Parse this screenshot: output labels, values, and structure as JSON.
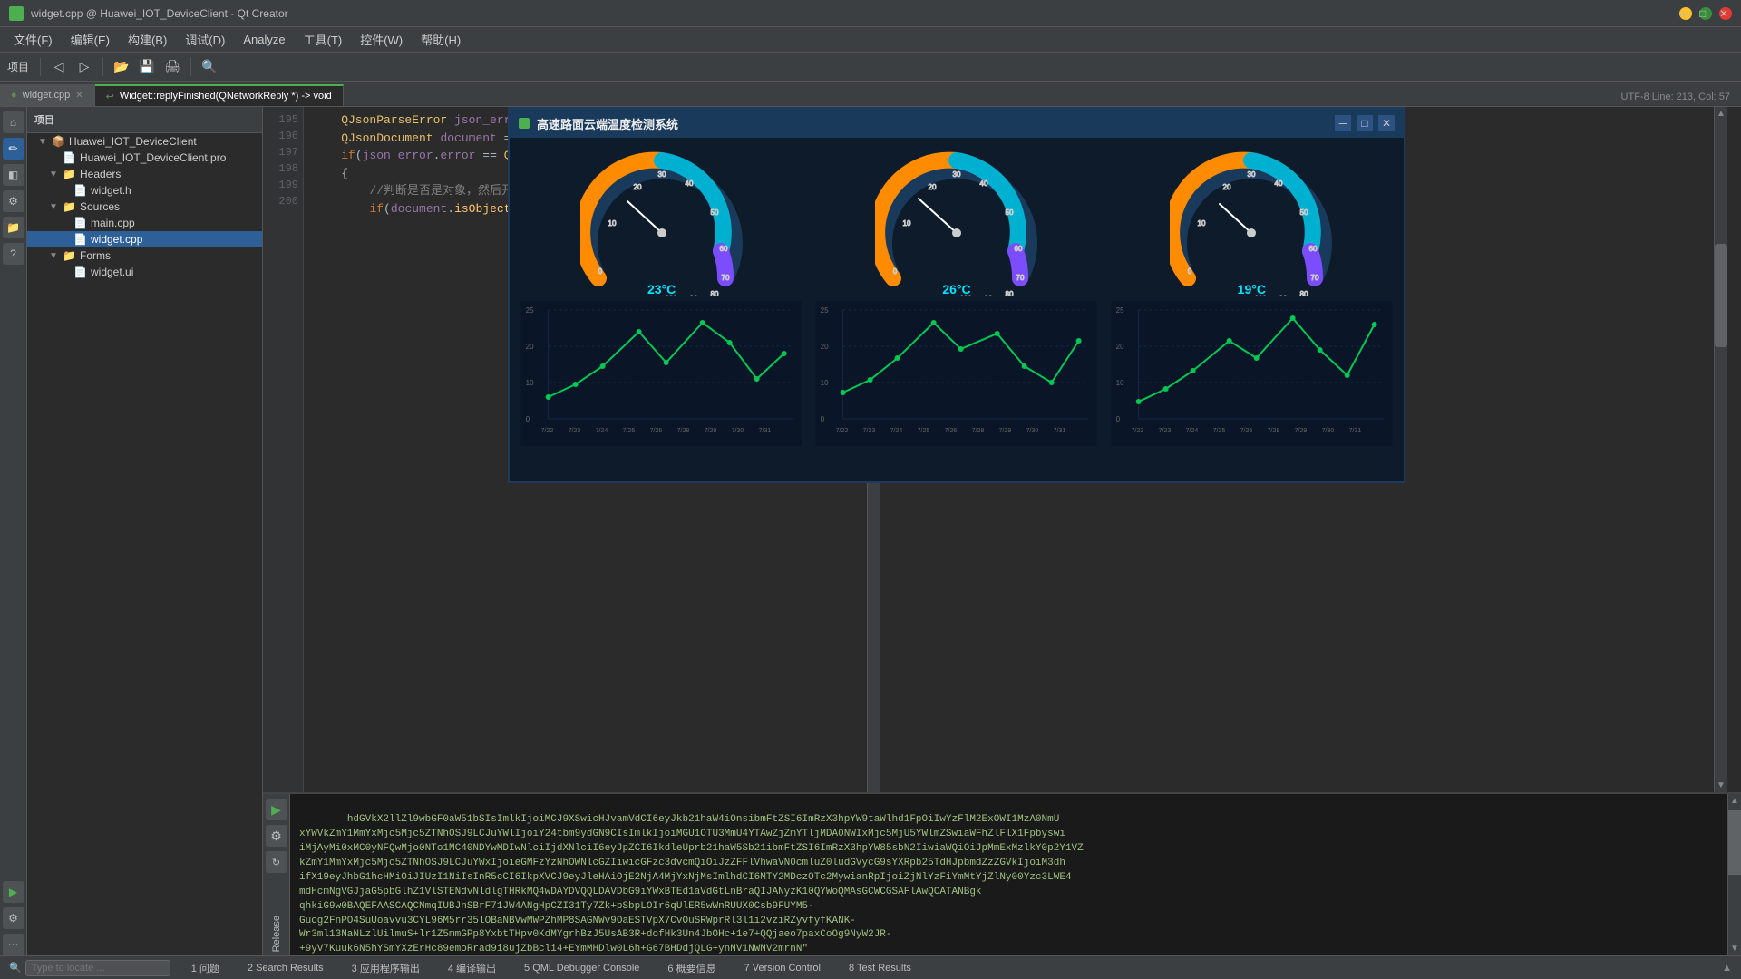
{
  "titleBar": {
    "title": "widget.cpp @ Huawei_IOT_DeviceClient - Qt Creator",
    "icon": "qt-icon"
  },
  "menuBar": {
    "items": [
      "文件(F)",
      "编辑(E)",
      "构建(B)",
      "调试(D)",
      "Analyze",
      "工具(T)",
      "控件(W)",
      "帮助(H)"
    ]
  },
  "toolbar": {
    "projectSelector": "项目",
    "configSelector": ""
  },
  "tabs": [
    {
      "label": "widget.cpp",
      "active": true,
      "closeable": true
    },
    {
      "label": "Widget::replyFinished(QNetworkReply *) -> void",
      "active": false,
      "closeable": false
    }
  ],
  "tabInfo": "UTF-8  Line: 213, Col: 57",
  "sidebar": {
    "projectLabel": "项目",
    "leftIcons": [
      "迎",
      "编辑",
      "设计",
      "Debug",
      "项目",
      "帮助"
    ]
  },
  "projectTree": {
    "root": "Huawei_IOT_DeviceClient",
    "children": [
      {
        "name": "Huawei_IOT_DeviceClient.pro",
        "type": "file",
        "indent": 2
      },
      {
        "name": "Headers",
        "type": "folder",
        "indent": 1,
        "expanded": true
      },
      {
        "name": "widget.h",
        "type": "file",
        "indent": 2
      },
      {
        "name": "Sources",
        "type": "folder",
        "indent": 1,
        "expanded": true
      },
      {
        "name": "main.cpp",
        "type": "file",
        "indent": 2
      },
      {
        "name": "widget.cpp",
        "type": "file",
        "indent": 2,
        "selected": true
      },
      {
        "name": "Forms",
        "type": "folder",
        "indent": 1,
        "expanded": true
      },
      {
        "name": "widget.ui",
        "type": "file",
        "indent": 2
      }
    ]
  },
  "codeLines": [
    {
      "num": 195,
      "code": "    QJsonParseError json_error;"
    },
    {
      "num": 196,
      "code": "    QJsonDocument document = QJsonDocument::fromJson(replyData, &json_error);"
    },
    {
      "num": 197,
      "code": "    if(json_error.error == QJsonParseError::NoError)"
    },
    {
      "num": 198,
      "code": "    {"
    },
    {
      "num": 199,
      "code": "        //判断是否是对象，然后开始解析数据"
    },
    {
      "num": 200,
      "code": "        if(document.isObject())"
    }
  ],
  "floatWindow": {
    "title": "高速路面云端温度检测系统",
    "gauges": [
      {
        "temp": "23°C",
        "color": "#00e5ff"
      },
      {
        "temp": "26°C",
        "color": "#00e5ff"
      },
      {
        "temp": "19°C",
        "color": "#00e5ff"
      }
    ],
    "charts": [
      {
        "yMax": 25,
        "dates": [
          "7/22",
          "7/23",
          "7/24",
          "7/25",
          "7/26",
          "7/28",
          "7/29",
          "7/30",
          "7/31"
        ],
        "values": [
          5,
          8,
          12,
          20,
          13,
          22,
          18,
          9,
          15
        ]
      },
      {
        "yMax": 25,
        "dates": [
          "7/22",
          "7/23",
          "7/24",
          "7/25",
          "7/26",
          "7/28",
          "7/29",
          "7/30",
          "7/31"
        ],
        "values": [
          6,
          9,
          14,
          22,
          16,
          19,
          12,
          8,
          18
        ]
      },
      {
        "yMax": 25,
        "dates": [
          "7/22",
          "7/23",
          "7/24",
          "7/25",
          "7/26",
          "7/28",
          "7/29",
          "7/30",
          "7/31"
        ],
        "values": [
          4,
          7,
          11,
          18,
          14,
          21,
          16,
          10,
          20
        ]
      }
    ]
  },
  "bottomText": {
    "content": "hdGVkX2llZl9wbGF0aW51bSIsImlkIjoiMCJ9XSwicHJvamVdCI6eyJkb21haW4iOnsibmFtZSI6ImRzX3hpYW9taWlhd1FpOiIwYzFlM2ExOWI1MzA0NmU\nxYWVkZmY1MmYxMjc5Mjc5ZTNhOSJ9LCJuYWlIjoiY24tbm9ydGN9CIsImlkIjoiMGU1OTU3MmU4YTAwZjZmYTljMDA0NWIxMjc5MjU5YWlmZSwiaWFhZlFlX1Fpbyswi\niMjAyMi0xMC0yNFQwMjo0NTo1MC40NDYwMDIwNlciIjdXNlciI6eyJpZCI6IkdleUprb21haW5Sb21ibmFtZSI6ImRzX3hpYW85sbN2IiwiaWQiOiJpMmExMzlkY0p2Y1VZ\nkZmY1MmYxMjc5Mjc5ZTNhOSJ9LCJuYWxIjoieGMFzYzNhOWNlcGZIiwicGFzc3dvcmQiOiJzZFFlVhwaVN0cmluZ0ludGVycG9sYXRpb25TdHJpbmdZzZGVkIjoiM3dh\nifX19eyJhbG1hcHMiOiJIUzI1NiIsInR5cCI6IkpXVCJ9eyJleHAiOjE2NjA4MjYxNjMsImlhdCI6MTY2MDczOTc2MywianRpIjoiZjNlYzFiYmMtYjZlNy00Yzc3LWE4\nmdHcmNgVGJjaG5pbGlhZ1VlSTENdvNldlgTHRkMQ4wDAYDVQQLDAVDbG9iYWxBTEd1aVdGtLnBraQIJANyzK10QYWoQMAsGCWCGSAFlAwQCATANBgk\nqhkiG9w0BAQEFAASCAQCNmqIUBJnSBrF71JW4ANgHpCZI31Ty7Zk+pSbpLOIr6qUlER5wWnRUUX0Csb9FUYM5-\nGuog2FnPO4SuUoavvu3CYL96M5rr35lOBaNBVwMWPZhMP8SAGNWv9OaESTVpX7CvOuSRWprRl3l1i2vziRZyvfyfKANK-\nWr3ml13NaNLzlUilmuS+lr1Z5mmGPp8YxbtTHpv0KdMYgrhBzJ5UsAB3R+dofHk3Un4JbOHc+1e7+QQjaeo7paxCoOg9NyW2JR-\n+9yV7Kuuk6N5hYSmYXzErHc89emoRrad9i8ujZbBcli4+EYmMHDlw0L6h+G67BHDdjQLG+ynNV1NWNV2mrnN\""
  },
  "bottomTabs": [
    {
      "num": 1,
      "label": "问题"
    },
    {
      "num": 2,
      "label": "Search Results"
    },
    {
      "num": 3,
      "label": "应用程序输出"
    },
    {
      "num": 4,
      "label": "编译输出"
    },
    {
      "num": 5,
      "label": "QML Debugger Console"
    },
    {
      "num": 6,
      "label": "概要信息"
    },
    {
      "num": 7,
      "label": "Version Control"
    },
    {
      "num": 8,
      "label": "Test Results"
    }
  ],
  "searchBox": {
    "placeholder": "Type to locate ..."
  },
  "leftIcons": [
    {
      "label": "欢迎",
      "icon": "⌂"
    },
    {
      "label": "编辑",
      "icon": "✏"
    },
    {
      "label": "设计",
      "icon": "◧"
    },
    {
      "label": "Debug",
      "icon": "🐛"
    },
    {
      "label": "项目",
      "icon": "📁"
    },
    {
      "label": "帮助",
      "icon": "?"
    }
  ],
  "bottomLeftIcons": [
    {
      "icon": "▶",
      "label": "run"
    },
    {
      "icon": "⚙",
      "label": "build"
    },
    {
      "icon": "↻",
      "label": "debug"
    },
    {
      "label": "Release",
      "text": true
    }
  ]
}
